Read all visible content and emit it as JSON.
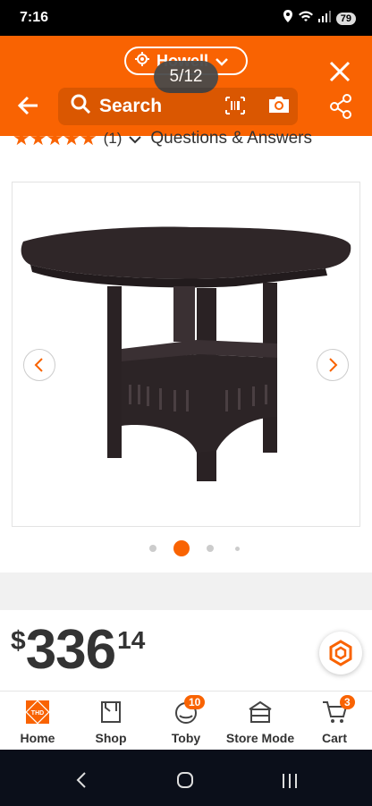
{
  "status_bar": {
    "time": "7:16",
    "battery": "79"
  },
  "header": {
    "store_name": "Howell",
    "image_counter": "5/12",
    "search_placeholder": "Search"
  },
  "rating": {
    "stars": "★★★★★",
    "count": "(1)",
    "qa_label": "Questions & Answers"
  },
  "gallery": {
    "active_index": 1,
    "dot_count": 4
  },
  "price": {
    "currency": "$",
    "dollars": "336",
    "cents": "14"
  },
  "bottom_nav": [
    {
      "label": "Home",
      "icon": "home-depot-logo-icon"
    },
    {
      "label": "Shop",
      "icon": "shop-icon"
    },
    {
      "label": "Toby",
      "icon": "toby-icon",
      "badge": "10"
    },
    {
      "label": "Store Mode",
      "icon": "store-icon"
    },
    {
      "label": "Cart",
      "icon": "cart-icon",
      "badge": "3"
    }
  ],
  "colors": {
    "brand": "#f96302",
    "text": "#333333"
  }
}
